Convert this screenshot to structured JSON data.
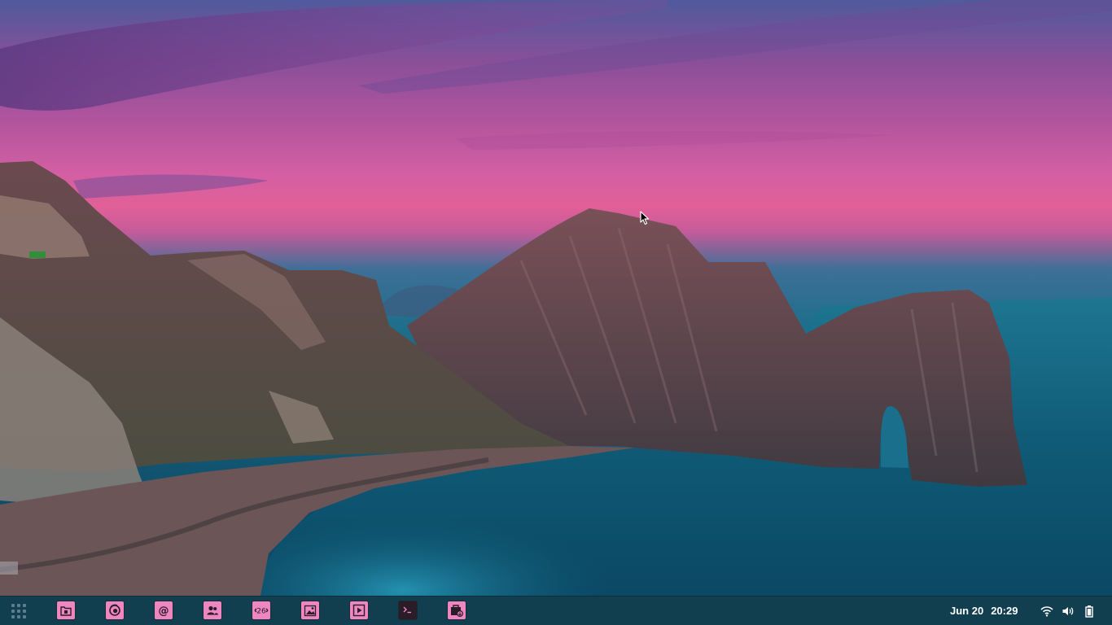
{
  "desktop": {
    "wallpaper": "sea-arch-at-dusk",
    "colors": {
      "sky_pink": "#e16097",
      "sky_violet": "#8a4f99",
      "sea_teal": "#155f7b",
      "cliff": "#6f4a4c",
      "taskbar": "#113f4f",
      "icon_pink": "#ee86c2"
    }
  },
  "taskbar": {
    "launcher_icon": "app-grid-icon",
    "dock": [
      {
        "name": "files-icon"
      },
      {
        "name": "browser-icon"
      },
      {
        "name": "mail-icon"
      },
      {
        "name": "contacts-icon"
      },
      {
        "name": "calendar-icon",
        "text": "26"
      },
      {
        "name": "photos-icon"
      },
      {
        "name": "video-player-icon"
      },
      {
        "name": "terminal-icon"
      },
      {
        "name": "app-center-icon"
      }
    ],
    "date": "Jun 20",
    "time": "20:29",
    "tray": [
      "wifi-icon",
      "volume-icon",
      "battery-icon"
    ]
  }
}
